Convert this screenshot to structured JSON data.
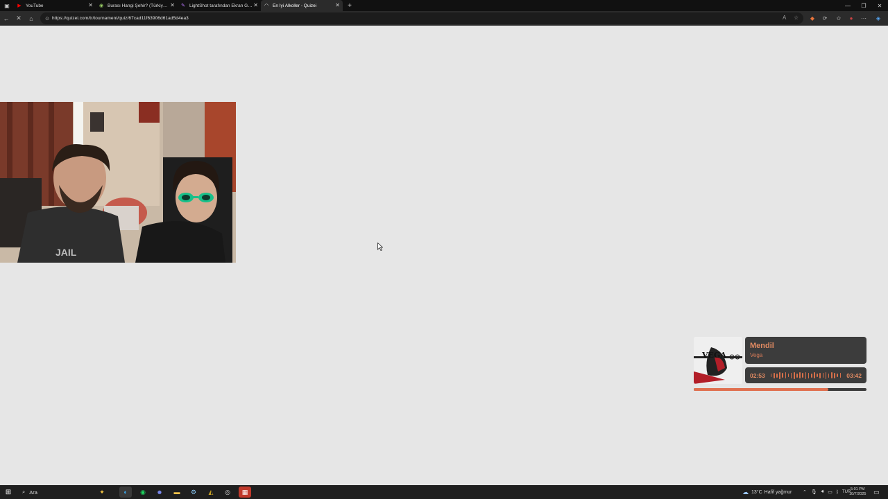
{
  "browser": {
    "tabs": [
      {
        "label": "YouTube",
        "active": false
      },
      {
        "label": "Burası Hangi Şehir? (Türkiye) - Q",
        "active": false
      },
      {
        "label": "LightShot tarafından Ekran Görü",
        "active": false
      },
      {
        "label": "En İyi Alkoller - Quizei",
        "active": true
      }
    ],
    "url": "https://quizei.com/tr/tournament/quiz/67cad11f63906d61ad5d4ea3"
  },
  "now_playing": {
    "title": "Mendil",
    "artist": "Vega",
    "elapsed": "02:53",
    "duration": "03:42",
    "progress": 0.78,
    "album_art_text": "VEGA",
    "accent": "#e07050"
  },
  "taskbar": {
    "search_label": "Ara",
    "weather_temp": "13°C",
    "weather_desc": "Hafif yağmur",
    "language": "TUR",
    "time": "5:01 PM",
    "date": "10/7/2025"
  }
}
